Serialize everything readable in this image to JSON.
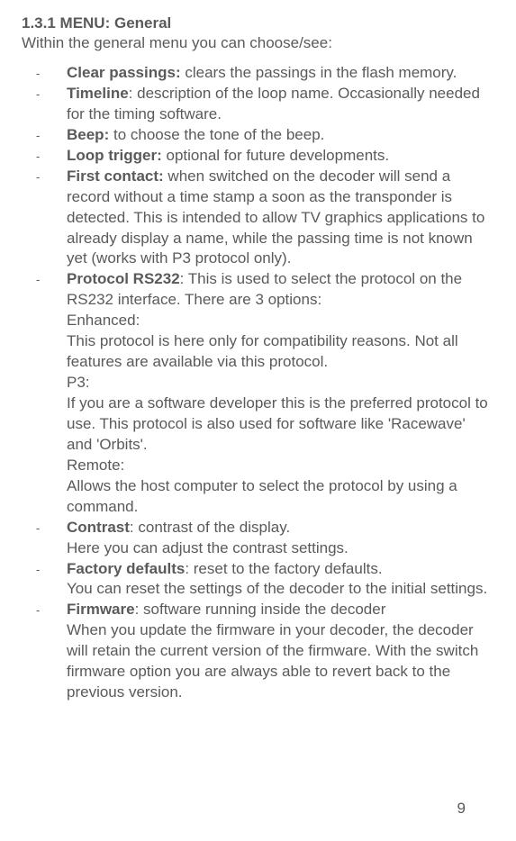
{
  "section_title": "1.3.1 MENU: General",
  "intro": "Within the general menu you can choose/see:",
  "bullet": "-",
  "items": [
    {
      "term": "Clear passings:",
      "sep": " ",
      "desc": "clears the passings in the flash memory."
    },
    {
      "term": "Timeline",
      "sep": ": ",
      "desc": "description of the loop name. Occasionally needed for the timing software."
    },
    {
      "term": "Beep:",
      "sep": " ",
      "desc": "to choose the tone of the beep."
    },
    {
      "term": "Loop trigger:",
      "sep": " ",
      "desc": "optional for future developments."
    },
    {
      "term": "First contact:",
      "sep": " ",
      "desc": "when switched on the decoder will send a record without a time stamp a soon as the transponder is detected. This is intended to allow TV graphics applications to already display a name, while the passing time is not known yet (works with P3 protocol only)."
    },
    {
      "term": "Protocol RS232",
      "sep": ": ",
      "desc": "This is used to select the protocol on the RS232 interface. There are 3 options:",
      "subs": [
        "Enhanced:",
        "This protocol is here only for compatibility reasons. Not all features are available via this protocol.",
        "P3:",
        "If you are a software developer this is the preferred protocol to use. This protocol is also used for software like 'Racewave' and 'Orbits'.",
        "Remote:",
        "Allows the host computer to select the protocol by using a command."
      ]
    },
    {
      "term": "Contrast",
      "sep": ": ",
      "desc": "contrast of the display.",
      "subs": [
        "Here you can adjust the contrast settings."
      ]
    },
    {
      "term": "Factory defaults",
      "sep": ": ",
      "desc": "reset to the factory defaults.",
      "subs": [
        "You can reset the settings of the decoder to the initial settings."
      ]
    },
    {
      "term": "Firmware",
      "sep": ": ",
      "desc": "software running inside the decoder",
      "subs": [
        "When you update the firmware in your decoder, the decoder will retain the current version of the firmware. With the switch firmware option you are always able to revert back to the previous version."
      ]
    }
  ],
  "page_number": "9"
}
